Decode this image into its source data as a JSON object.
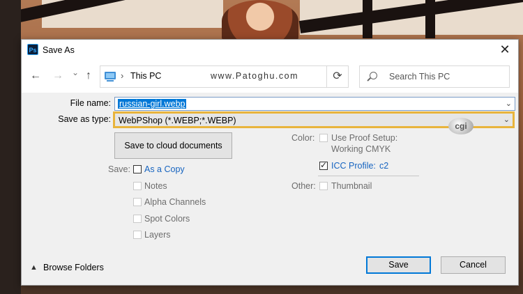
{
  "window": {
    "title": "Save As",
    "app_icon": "Ps",
    "close_icon": "close-icon"
  },
  "nav": {
    "back": "←",
    "forward": "→",
    "recent": "⌄",
    "up": "↑",
    "location": "This PC",
    "breadcrumb_arrow": "›",
    "watermark": "www.Patoghu.com",
    "dropdown": "⌄",
    "refresh": "⟳",
    "search_placeholder": "Search This PC"
  },
  "form": {
    "file_name_label": "File name:",
    "file_name_value": "russian-girl.webp",
    "save_as_type_label": "Save as type:",
    "save_as_type_value": "WebPShop (*.WEBP;*.WEBP)",
    "dropdown_arrow": "⌄",
    "cloud_button": "Save to cloud documents"
  },
  "save_options": {
    "label": "Save:",
    "items": [
      {
        "label": "As a Copy",
        "checked": false,
        "enabled": true
      },
      {
        "label": "Notes",
        "checked": false,
        "enabled": false
      },
      {
        "label": "Alpha Channels",
        "checked": false,
        "enabled": false
      },
      {
        "label": "Spot Colors",
        "checked": false,
        "enabled": false
      },
      {
        "label": "Layers",
        "checked": false,
        "enabled": false
      }
    ]
  },
  "color_options": {
    "label": "Color:",
    "proof_line1": "Use Proof Setup:",
    "proof_line2": "Working CMYK",
    "icc_label": "ICC Profile:",
    "icc_value": "c2",
    "icc_check": "✓"
  },
  "other_options": {
    "label": "Other:",
    "thumbnail": "Thumbnail"
  },
  "footer": {
    "browse_folders": "Browse Folders",
    "chevron": "⌃",
    "save": "Save",
    "cancel": "Cancel"
  },
  "badge": "cgi"
}
